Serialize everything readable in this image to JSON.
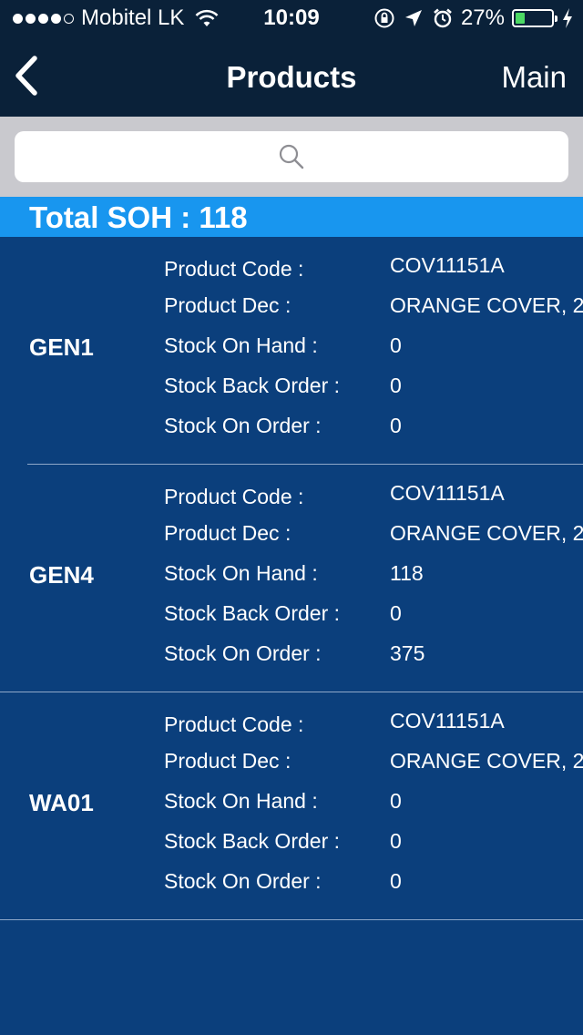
{
  "status_bar": {
    "carrier": "Mobitel LK",
    "time": "10:09",
    "battery_percent": "27%",
    "battery_level": 0.27,
    "signal_bars_filled": 4,
    "signal_bars_total": 5,
    "icons": [
      "wifi-icon",
      "orientation-lock-icon",
      "location-arrow-icon",
      "alarm-icon",
      "battery-icon",
      "charging-bolt-icon"
    ]
  },
  "nav": {
    "title": "Products",
    "right_label": "Main",
    "back_icon": "chevron-left-icon"
  },
  "search": {
    "placeholder": "",
    "icon": "search-icon"
  },
  "total": {
    "text": "Total SOH : 118"
  },
  "labels": {
    "product_code": "Product Code :",
    "product_dec": "Product Dec :",
    "stock_on_hand": "Stock On Hand :",
    "stock_back_order": "Stock Back Order :",
    "stock_on_order": "Stock On Order :"
  },
  "products": [
    {
      "location": "GEN1",
      "product_code": "COV11151A",
      "product_dec": "ORANGE COVER, 2",
      "stock_on_hand": "0",
      "stock_back_order": "0",
      "stock_on_order": "0"
    },
    {
      "location": "GEN4",
      "product_code": "COV11151A",
      "product_dec": "ORANGE COVER, 2",
      "stock_on_hand": "118",
      "stock_back_order": "0",
      "stock_on_order": "375"
    },
    {
      "location": "WA01",
      "product_code": "COV11151A",
      "product_dec": "ORANGE COVER, 2",
      "stock_on_hand": "0",
      "stock_back_order": "0",
      "stock_on_order": "0"
    }
  ],
  "colors": {
    "nav_background": "#0a2139",
    "list_background": "#0b3f7c",
    "total_bar": "#1896ef",
    "search_area": "#c9c9ce",
    "battery_fill": "#4cd964"
  }
}
